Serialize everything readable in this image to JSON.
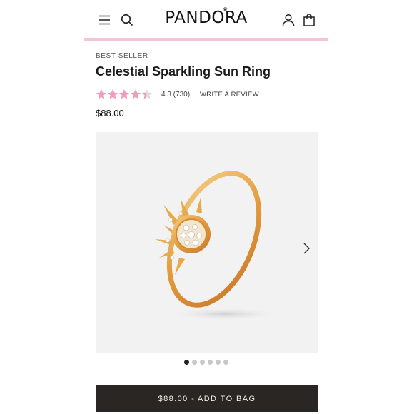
{
  "header": {
    "brand": "PANDORA",
    "icons": [
      "menu-icon",
      "search-icon",
      "account-icon",
      "shopping-bag-icon"
    ]
  },
  "product": {
    "badge": "BEST SELLER",
    "title": "Celestial Sparkling Sun Ring",
    "rating": 4.3,
    "rating_text": "4.3 (730)",
    "write_review": "WRITE A REVIEW",
    "price": "$88.00"
  },
  "gallery": {
    "image_subject": "gold sun ring",
    "slide_count": 6,
    "active_slide": 1
  },
  "cta": {
    "label": "$88.00 - ADD TO BAG"
  },
  "colors": {
    "accent_pink": "#f4c6d3",
    "star_pink": "#f29bbd",
    "button_bg": "#2a2623",
    "ring_gold": "#e8a94a"
  }
}
